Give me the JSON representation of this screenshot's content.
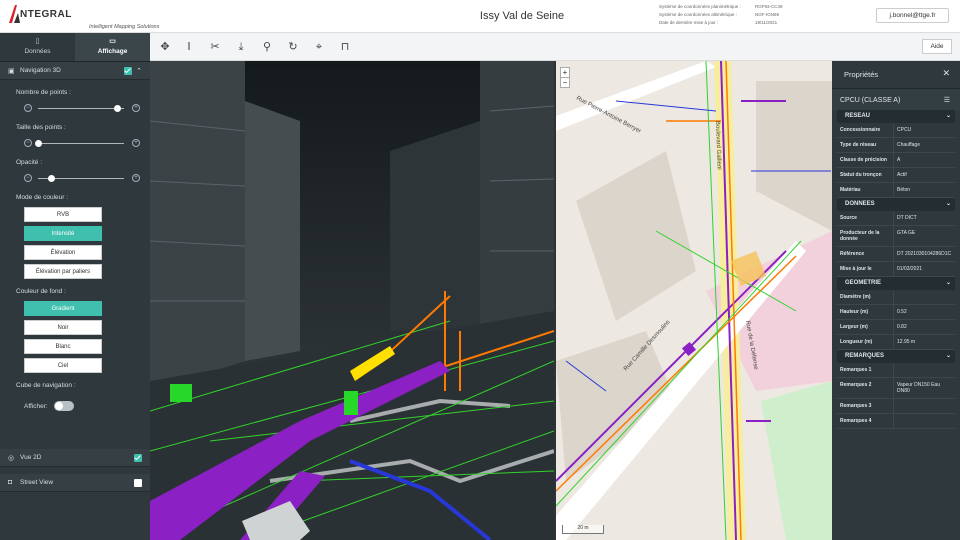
{
  "header": {
    "logo_text": "NTEGRAL",
    "tagline": "Intelligent Mapping Solutions",
    "title": "Issy Val de Seine",
    "sysinfo": [
      {
        "label": "Système de coordonnées planimétrique :",
        "value": "RGF93-CC49"
      },
      {
        "label": "Système de coordonnées altimétrique :",
        "value": "NGF-IGN69"
      },
      {
        "label": "Date de dernière mise à jour :",
        "value": "19/11/2021"
      }
    ],
    "user": "j.bonnel@ttge.fr"
  },
  "left_panel": {
    "tabs": [
      {
        "label": "Données",
        "icon": "file-icon"
      },
      {
        "label": "Affichage",
        "icon": "monitor-icon"
      }
    ],
    "nav3d": {
      "label": "Navigation 3D",
      "checked": true,
      "points_count_label": "Nombre de points :",
      "points_count_value": 0.92,
      "points_size_label": "Taille des points :",
      "points_size_value": 0.0,
      "opacity_label": "Opacité :",
      "opacity_value": 0.15,
      "color_mode_label": "Mode de couleur :",
      "color_modes": [
        "RVB",
        "Intensité",
        "Élévation",
        "Élévation par paliers"
      ],
      "color_mode_selected": "Intensité",
      "bg_color_label": "Couleur de fond :",
      "bg_colors": [
        "Gradient",
        "Noir",
        "Blanc",
        "Ciel"
      ],
      "bg_color_selected": "Gradient",
      "nav_cube_label": "Cube de navigation :",
      "show_label": "Afficher:",
      "show_on": false
    },
    "vue2d": {
      "label": "Vue 2D",
      "checked": true
    },
    "streetview": {
      "label": "Street View",
      "checked": false
    }
  },
  "toolbar": {
    "tools": [
      "move-icon",
      "text-cursor-icon",
      "scissors-icon",
      "download-icon",
      "pin-icon",
      "refresh-icon",
      "location-marker-icon",
      "lock-icon"
    ],
    "help_label": "Aide"
  },
  "map": {
    "streets": [
      "Rue Pierre-Antoine Berryer",
      "Boulevard Gallieni",
      "Rue Camille Desmoulins",
      "Rue de la Défense"
    ],
    "zoom_in": "+",
    "zoom_out": "−",
    "scale_label": "20 m"
  },
  "properties": {
    "title": "Propriétés",
    "object_title": "CPCU (CLASSE A)",
    "groups": [
      {
        "name": "RESEAU",
        "rows": [
          {
            "k": "Concessionnaire",
            "v": "CPCU"
          },
          {
            "k": "Type de réseau",
            "v": "Chauffage"
          },
          {
            "k": "Classe de précision",
            "v": "A"
          },
          {
            "k": "Statut du tronçon",
            "v": "Actif"
          },
          {
            "k": "Matériau",
            "v": "Béton"
          }
        ]
      },
      {
        "name": "DONNEES",
        "rows": [
          {
            "k": "Source",
            "v": "DT DICT"
          },
          {
            "k": "Producteur de la donnée",
            "v": "GTA GE"
          },
          {
            "k": "Référence",
            "v": "DT 2021030104286D1C"
          },
          {
            "k": "Mise à jour le",
            "v": "01/03/2021"
          }
        ]
      },
      {
        "name": "GEOMETRIE",
        "rows": [
          {
            "k": "Diamètre (m)",
            "v": ""
          },
          {
            "k": "Hauteur (m)",
            "v": "0.52"
          },
          {
            "k": "Largeur (m)",
            "v": "0.82"
          },
          {
            "k": "Longueur (m)",
            "v": "12.95 m"
          }
        ]
      },
      {
        "name": "REMARQUES",
        "rows": [
          {
            "k": "Remarques 1",
            "v": ""
          },
          {
            "k": "Remarques 2",
            "v": "Vapeur DN150 Eau DN80"
          },
          {
            "k": "Remarques 3",
            "v": ""
          },
          {
            "k": "Remarques 4",
            "v": ""
          }
        ]
      }
    ]
  },
  "colors": {
    "accent": "#3fbfae",
    "panel": "#2e383d",
    "heating_network": "#8b20c4",
    "gas_network": "#ffe000",
    "telecom_network": "#32d22c",
    "water_network": "#2838d8",
    "electric_network": "#ff7a00"
  }
}
